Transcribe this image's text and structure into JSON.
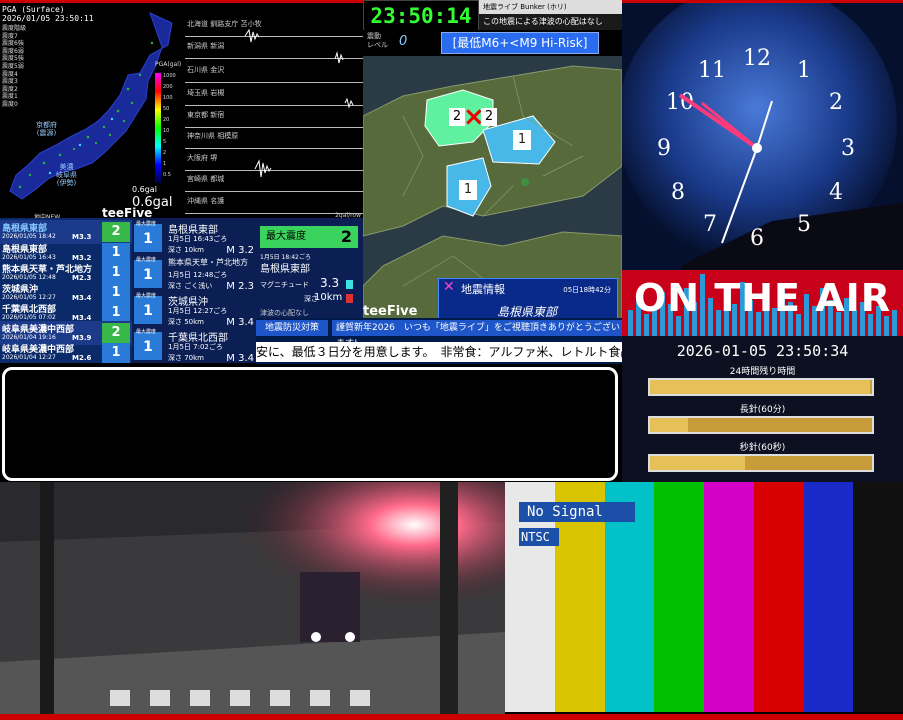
{
  "pga_panel": {
    "header_line1": "PGA (Surface)",
    "header_line2": "2026/01/05 23:50:11",
    "legend": [
      "震度階級",
      "震度7",
      "震度6強",
      "震度6弱",
      "震度5強",
      "震度5弱",
      "震度4",
      "震度3",
      "震度2",
      "震度1",
      "震度0"
    ],
    "scale_title": "PGA(gal)",
    "scale_ticks": [
      "1000",
      "200",
      "100",
      "50",
      "20",
      "10",
      "5",
      "2",
      "1",
      "0.5"
    ],
    "city_labels": [
      "京都府",
      "(震源)",
      "美濃",
      "岐阜県",
      "(伊勢)"
    ],
    "value_small": "0.6gal",
    "value": "0.6gal",
    "small_brand": "地中NEW",
    "brand": "teeFive"
  },
  "seismogram": {
    "traces": [
      "北海道 釧路支庁 苫小牧",
      "新潟県 新潟",
      "石川県 金沢",
      "埼玉県 岩槻",
      "東京都 新宿",
      "神奈川県 相模原",
      "大阪府 堺",
      "宮崎県 都城",
      "沖縄県 名護"
    ],
    "unit": "2gal/row"
  },
  "seismic_map": {
    "clock": "23:50:14",
    "header_right_line1": "地震ライブ Bunker (ホリ)",
    "header_right_line2": "この地震による津波の心配はなし",
    "level_label": "震動\nレベル",
    "level_value": "0",
    "risk_label": "[最低M6+<M9 Hi-Risk]",
    "area_counts": [
      "2",
      "2",
      "1",
      "1"
    ],
    "info_title": "地震情報",
    "info_time": "05日18時42分",
    "info_region": "島根県東部",
    "brand": "teeFive"
  },
  "eq_list": [
    {
      "name": "島根県東部",
      "date": "2026/01/05 18:42",
      "mag": "M3.3",
      "intensity": "2"
    },
    {
      "name": "島根県東部",
      "date": "2026/01/05 16:43",
      "mag": "M3.2",
      "intensity": "1"
    },
    {
      "name": "熊本県天草・芦北地方",
      "date": "2026/01/05 12:48",
      "mag": "M2.3",
      "intensity": "1"
    },
    {
      "name": "茨城県沖",
      "date": "2026/01/05 12:27",
      "mag": "M3.4",
      "intensity": "1"
    },
    {
      "name": "千葉県北西部",
      "date": "2026/01/05 07:02",
      "mag": "M3.4",
      "intensity": "1"
    },
    {
      "name": "岐阜県美濃中西部",
      "date": "2026/01/04 19:16",
      "mag": "M3.9",
      "intensity": "2"
    },
    {
      "name": "岐阜県美濃中西部",
      "date": "2026/01/04 12:27",
      "mag": "M2.6",
      "intensity": "1"
    }
  ],
  "eq_list_small_label": "最大震度",
  "eq_detail": [
    {
      "name": "島根県東部",
      "date": "1月5日 16:43ごろ",
      "depth": "深さ 10km",
      "mag": "M 3.2",
      "intensity": "1"
    },
    {
      "name": "熊本県天草・芦北地方",
      "date": "1月5日 12:48ごろ",
      "depth": "深さ ごく浅い",
      "mag": "M 2.3",
      "intensity": "1"
    },
    {
      "name": "茨城県沖",
      "date": "1月5日 12:27ごろ",
      "depth": "深さ 50km",
      "mag": "M 3.4",
      "intensity": "1"
    },
    {
      "name": "千葉県北西部",
      "date": "1月5日 7:02ごろ",
      "depth": "深さ 70km",
      "mag": "M 3.4",
      "intensity": "1"
    }
  ],
  "max_intensity": {
    "label": "最大震度",
    "value": "2",
    "date": "1月5日 18:42ごろ",
    "region": "島根県東部",
    "mag_label": "マグニチュード",
    "mag_value": "3.3",
    "depth_label": "深さ",
    "depth_value": "10km",
    "tsunami": "津波の心配なし"
  },
  "ticker": {
    "tag": "地震防災対策",
    "message": "謹賀新年2026　いつも「地震ライブ」をご視聴頂きありがとうございます!",
    "scroll": "安に、最低３日分を用意します。　非常食：アルファ米、レトルト食品"
  },
  "clock_panel": {
    "numbers": [
      "12",
      "1",
      "2",
      "3",
      "4",
      "5",
      "6",
      "7",
      "8",
      "9",
      "10",
      "11"
    ]
  },
  "on_air": {
    "label": "ON THE AIR"
  },
  "countdown": {
    "datetime": "2026-01-05 23:50:34",
    "label_day": "24時間残り時間",
    "label_hour": "長針(60分)",
    "label_min": "秒針(60秒)",
    "day_progress": 0.99,
    "hour_progress": 0.17,
    "minute_progress": 0.43
  },
  "test_pattern": {
    "no_signal": "No Signal",
    "standard": "NTSC",
    "colors": [
      "#e8e8e8",
      "#d8c400",
      "#00c2c8",
      "#00c000",
      "#d400c8",
      "#d80000",
      "#1a2ac8",
      "#101010"
    ]
  }
}
